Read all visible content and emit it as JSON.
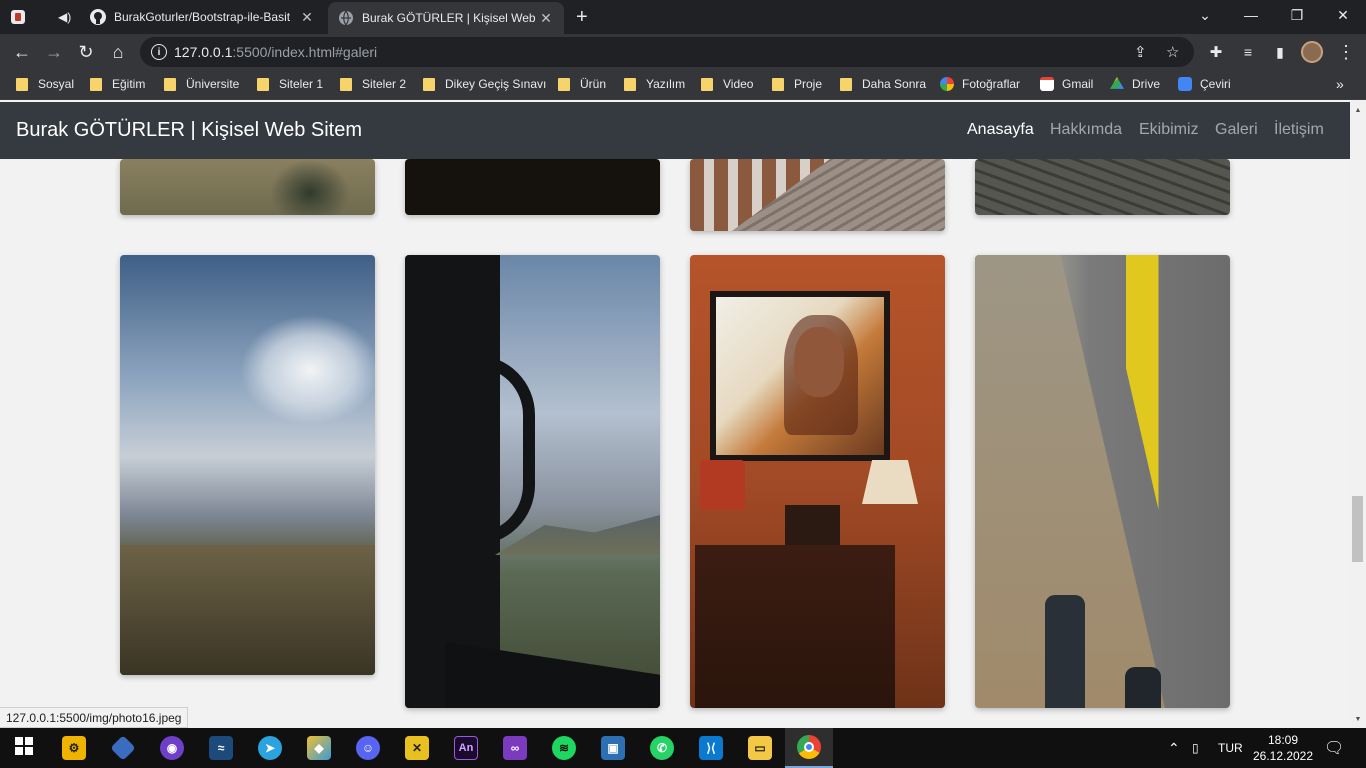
{
  "browser": {
    "tabs": [
      {
        "title": "",
        "favicon": "browser-app-icon",
        "audio": true
      },
      {
        "title": "BurakGoturler/Bootstrap-ile-Basit",
        "favicon": "github-icon"
      },
      {
        "title": "Burak GÖTÜRLER | Kişisel Web Sit",
        "favicon": "globe-icon",
        "active": true
      }
    ],
    "new_tab": "+",
    "url_host": "127.0.0.1",
    "url_rest": ":5500/index.html#galeri",
    "bookmarks": [
      "Sosyal",
      "Eğitim",
      "Üniversite",
      "Siteler 1",
      "Siteler 2",
      "Dikey Geçiş Sınavı",
      "Ürün",
      "Yazılım",
      "Video",
      "Proje",
      "Daha Sonra",
      "Fotoğraflar",
      "Gmail",
      "Drive",
      "Çeviri"
    ],
    "bookmarks_more": "»",
    "status_url": "127.0.0.1:5500/img/photo16.jpeg"
  },
  "site": {
    "brand": "Burak GÖTÜRLER | Kişisel Web Sitem",
    "nav": [
      "Anasayfa",
      "Hakkımda",
      "Ekibimiz",
      "Galeri",
      "İletişim"
    ],
    "active_nav": "Anasayfa"
  },
  "taskbar": {
    "language": "TUR",
    "time": "18:09",
    "date": "26.12.2022"
  },
  "colors": {
    "nav_bg": "#343a40",
    "page_bg": "#f2f2f2",
    "chrome_dark": "#202124",
    "chrome_toolbar": "#35363a"
  }
}
